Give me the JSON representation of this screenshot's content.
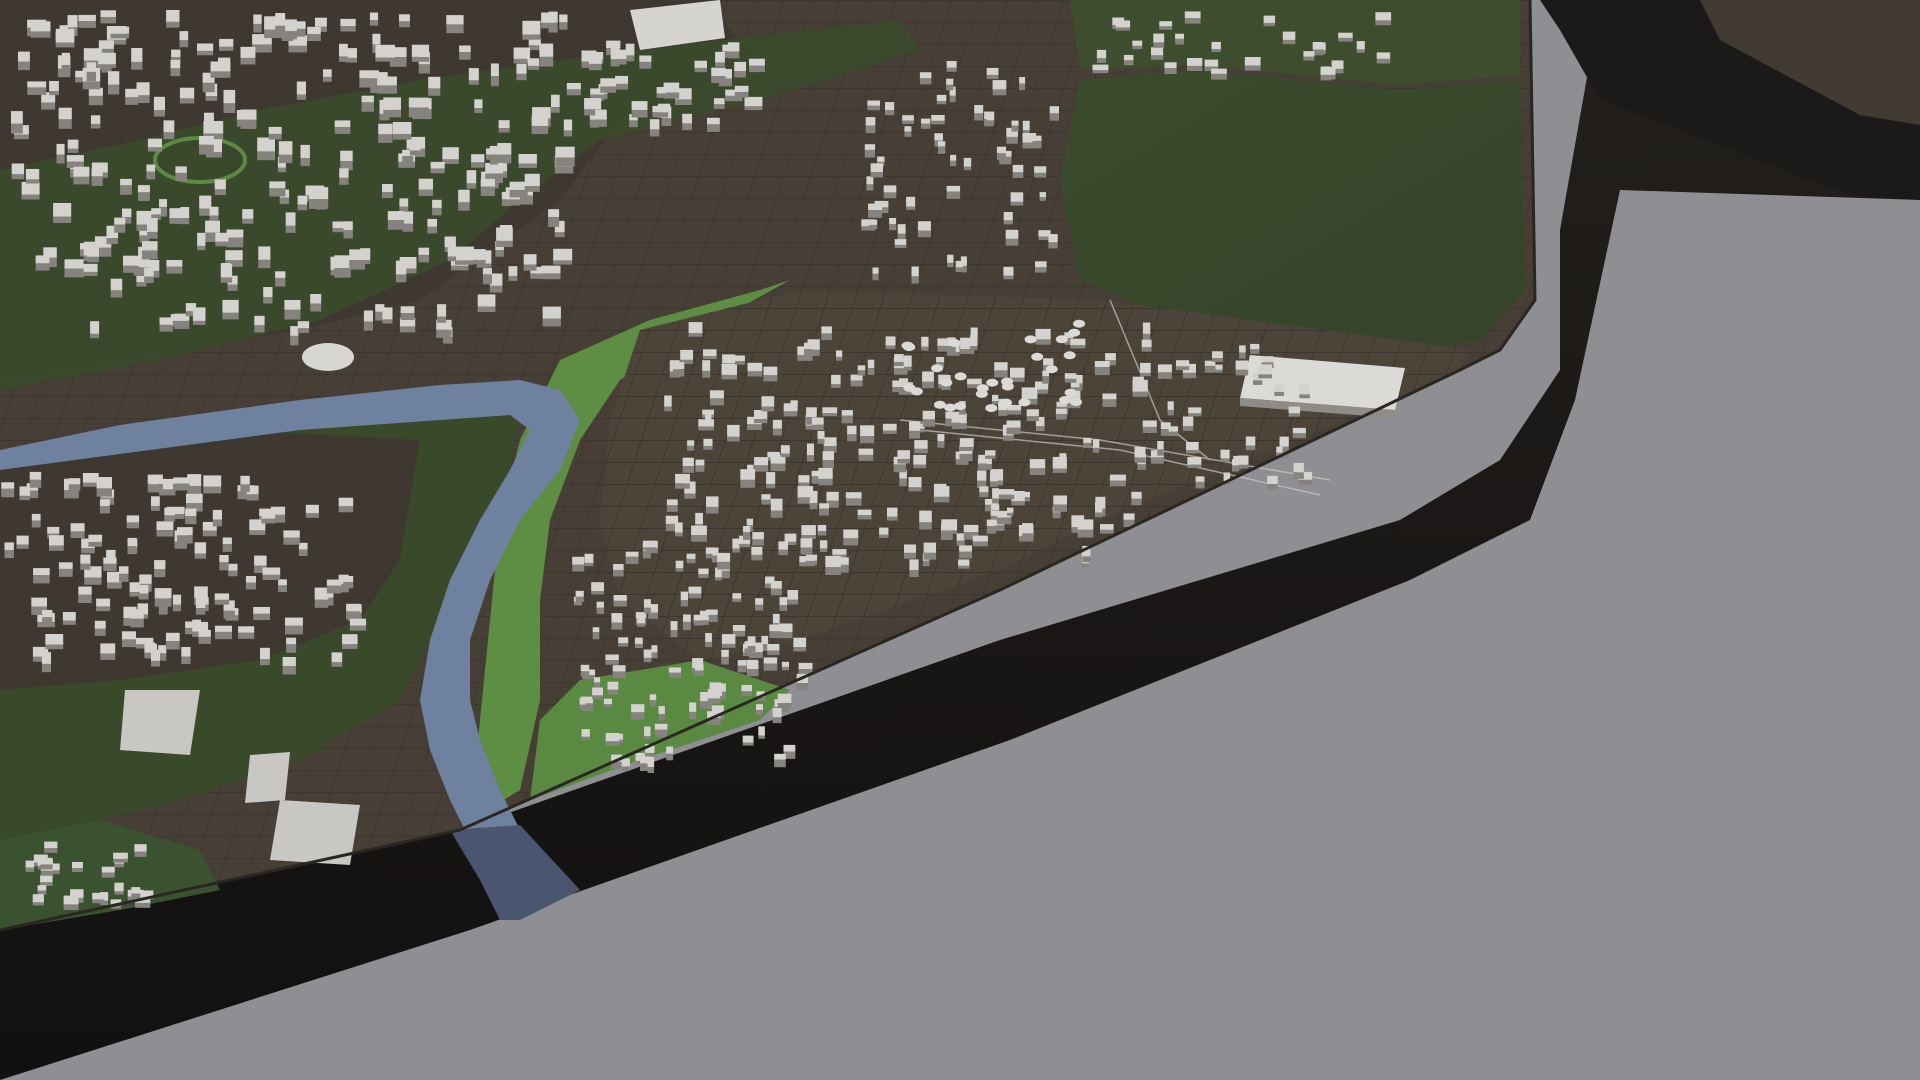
{
  "scene": {
    "kind": "3d-city-terrain-model",
    "colors": {
      "background": "#8f8e92",
      "model_side": "#1d1b19",
      "model_side_dark": "#141210",
      "ground": "#4a4238",
      "ground_dark": "#3e372f",
      "park": "#3a4a2c",
      "park_light": "#5f8f45",
      "river": "#6f82a0",
      "river_dark": "#4a5670",
      "building": "#d2d0cc",
      "building_shade": "#8a8782",
      "road": "#2e2925"
    },
    "features": [
      {
        "name": "river",
        "type": "waterway"
      },
      {
        "name": "industrial-zone",
        "type": "landuse"
      },
      {
        "name": "large-warehouse",
        "type": "building"
      },
      {
        "name": "residential-district-north",
        "type": "landuse"
      },
      {
        "name": "residential-district-west",
        "type": "landuse"
      },
      {
        "name": "forest-park-east",
        "type": "park"
      },
      {
        "name": "riverside-park",
        "type": "park"
      },
      {
        "name": "roundabout-plaza",
        "type": "landmark"
      },
      {
        "name": "stadium-oval",
        "type": "landmark"
      }
    ]
  }
}
